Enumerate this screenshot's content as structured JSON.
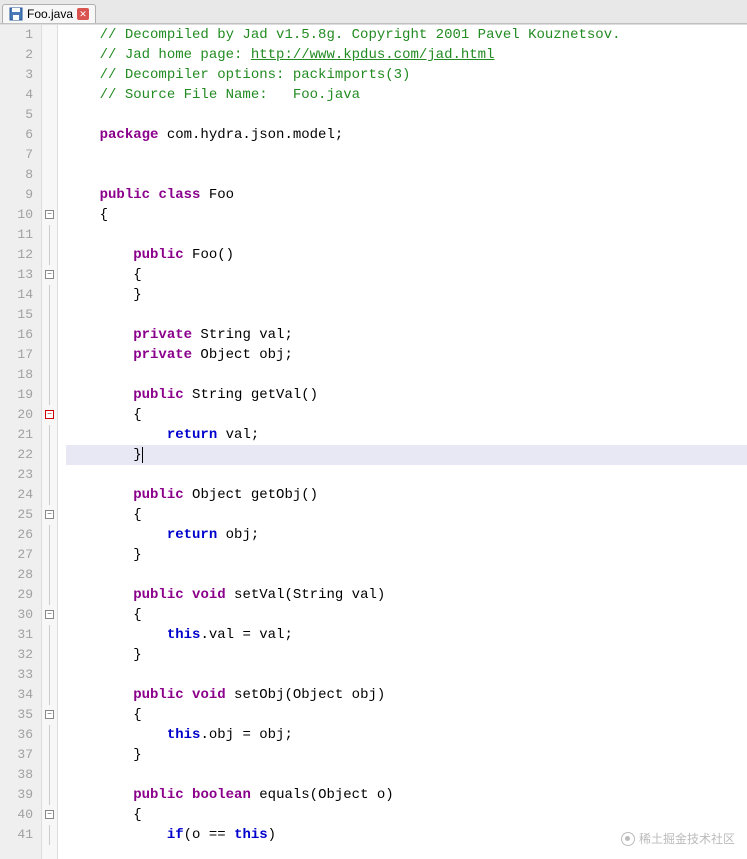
{
  "tab": {
    "filename": "Foo.java",
    "icon": "save-icon",
    "close_icon": "close-icon"
  },
  "watermark": "稀土掘金技术社区",
  "code": {
    "lines": [
      {
        "n": 1,
        "tokens": [
          {
            "t": "    ",
            "c": ""
          },
          {
            "t": "// Decompiled by Jad v1.5.8g. Copyright 2001 Pavel Kouznetsov.",
            "c": "c-comment"
          }
        ]
      },
      {
        "n": 2,
        "tokens": [
          {
            "t": "    ",
            "c": ""
          },
          {
            "t": "// Jad home page: ",
            "c": "c-comment"
          },
          {
            "t": "http://www.kpdus.com/jad.html",
            "c": "c-link"
          }
        ]
      },
      {
        "n": 3,
        "tokens": [
          {
            "t": "    ",
            "c": ""
          },
          {
            "t": "// Decompiler options: packimports(3) ",
            "c": "c-comment"
          }
        ]
      },
      {
        "n": 4,
        "tokens": [
          {
            "t": "    ",
            "c": ""
          },
          {
            "t": "// Source File Name:   Foo.java",
            "c": "c-comment"
          }
        ]
      },
      {
        "n": 5,
        "tokens": []
      },
      {
        "n": 6,
        "tokens": [
          {
            "t": "    ",
            "c": ""
          },
          {
            "t": "package",
            "c": "c-keyword"
          },
          {
            "t": " com.hydra.json.model;",
            "c": "c-default"
          }
        ]
      },
      {
        "n": 7,
        "tokens": []
      },
      {
        "n": 8,
        "tokens": []
      },
      {
        "n": 9,
        "tokens": [
          {
            "t": "    ",
            "c": ""
          },
          {
            "t": "public",
            "c": "c-keyword"
          },
          {
            "t": " ",
            "c": ""
          },
          {
            "t": "class",
            "c": "c-keyword"
          },
          {
            "t": " Foo",
            "c": "c-default"
          }
        ]
      },
      {
        "n": 10,
        "fold": "-",
        "tokens": [
          {
            "t": "    {",
            "c": "c-default"
          }
        ]
      },
      {
        "n": 11,
        "tokens": []
      },
      {
        "n": 12,
        "tokens": [
          {
            "t": "        ",
            "c": ""
          },
          {
            "t": "public",
            "c": "c-keyword"
          },
          {
            "t": " Foo()",
            "c": "c-default"
          }
        ]
      },
      {
        "n": 13,
        "fold": "-",
        "tokens": [
          {
            "t": "        {",
            "c": "c-default"
          }
        ]
      },
      {
        "n": 14,
        "tokens": [
          {
            "t": "        }",
            "c": "c-default"
          }
        ]
      },
      {
        "n": 15,
        "tokens": []
      },
      {
        "n": 16,
        "tokens": [
          {
            "t": "        ",
            "c": ""
          },
          {
            "t": "private",
            "c": "c-keyword"
          },
          {
            "t": " String val;",
            "c": "c-default"
          }
        ]
      },
      {
        "n": 17,
        "tokens": [
          {
            "t": "        ",
            "c": ""
          },
          {
            "t": "private",
            "c": "c-keyword"
          },
          {
            "t": " Object obj;",
            "c": "c-default"
          }
        ]
      },
      {
        "n": 18,
        "tokens": []
      },
      {
        "n": 19,
        "tokens": [
          {
            "t": "        ",
            "c": ""
          },
          {
            "t": "public",
            "c": "c-keyword"
          },
          {
            "t": " String getVal()",
            "c": "c-default"
          }
        ]
      },
      {
        "n": 20,
        "fold": "-red",
        "tokens": [
          {
            "t": "        {",
            "c": "c-default"
          }
        ]
      },
      {
        "n": 21,
        "tokens": [
          {
            "t": "            ",
            "c": ""
          },
          {
            "t": "return",
            "c": "c-keyword2"
          },
          {
            "t": " val;",
            "c": "c-default"
          }
        ]
      },
      {
        "n": 22,
        "hl": true,
        "caret": true,
        "tokens": [
          {
            "t": "        }",
            "c": "c-default"
          }
        ]
      },
      {
        "n": 23,
        "tokens": []
      },
      {
        "n": 24,
        "tokens": [
          {
            "t": "        ",
            "c": ""
          },
          {
            "t": "public",
            "c": "c-keyword"
          },
          {
            "t": " Object getObj()",
            "c": "c-default"
          }
        ]
      },
      {
        "n": 25,
        "fold": "-",
        "tokens": [
          {
            "t": "        {",
            "c": "c-default"
          }
        ]
      },
      {
        "n": 26,
        "tokens": [
          {
            "t": "            ",
            "c": ""
          },
          {
            "t": "return",
            "c": "c-keyword2"
          },
          {
            "t": " obj;",
            "c": "c-default"
          }
        ]
      },
      {
        "n": 27,
        "tokens": [
          {
            "t": "        }",
            "c": "c-default"
          }
        ]
      },
      {
        "n": 28,
        "tokens": []
      },
      {
        "n": 29,
        "tokens": [
          {
            "t": "        ",
            "c": ""
          },
          {
            "t": "public",
            "c": "c-keyword"
          },
          {
            "t": " ",
            "c": ""
          },
          {
            "t": "void",
            "c": "c-keyword"
          },
          {
            "t": " setVal(String val)",
            "c": "c-default"
          }
        ]
      },
      {
        "n": 30,
        "fold": "-",
        "tokens": [
          {
            "t": "        {",
            "c": "c-default"
          }
        ]
      },
      {
        "n": 31,
        "tokens": [
          {
            "t": "            ",
            "c": ""
          },
          {
            "t": "this",
            "c": "c-keyword2"
          },
          {
            "t": ".val = val;",
            "c": "c-default"
          }
        ]
      },
      {
        "n": 32,
        "tokens": [
          {
            "t": "        }",
            "c": "c-default"
          }
        ]
      },
      {
        "n": 33,
        "tokens": []
      },
      {
        "n": 34,
        "tokens": [
          {
            "t": "        ",
            "c": ""
          },
          {
            "t": "public",
            "c": "c-keyword"
          },
          {
            "t": " ",
            "c": ""
          },
          {
            "t": "void",
            "c": "c-keyword"
          },
          {
            "t": " setObj(Object obj)",
            "c": "c-default"
          }
        ]
      },
      {
        "n": 35,
        "fold": "-",
        "tokens": [
          {
            "t": "        {",
            "c": "c-default"
          }
        ]
      },
      {
        "n": 36,
        "tokens": [
          {
            "t": "            ",
            "c": ""
          },
          {
            "t": "this",
            "c": "c-keyword2"
          },
          {
            "t": ".obj = obj;",
            "c": "c-default"
          }
        ]
      },
      {
        "n": 37,
        "tokens": [
          {
            "t": "        }",
            "c": "c-default"
          }
        ]
      },
      {
        "n": 38,
        "tokens": []
      },
      {
        "n": 39,
        "tokens": [
          {
            "t": "        ",
            "c": ""
          },
          {
            "t": "public",
            "c": "c-keyword"
          },
          {
            "t": " ",
            "c": ""
          },
          {
            "t": "boolean",
            "c": "c-keyword"
          },
          {
            "t": " equals(Object o)",
            "c": "c-default"
          }
        ]
      },
      {
        "n": 40,
        "fold": "-",
        "tokens": [
          {
            "t": "        {",
            "c": "c-default"
          }
        ]
      },
      {
        "n": 41,
        "tokens": [
          {
            "t": "            ",
            "c": ""
          },
          {
            "t": "if",
            "c": "c-keyword2"
          },
          {
            "t": "(o == ",
            "c": "c-default"
          },
          {
            "t": "this",
            "c": "c-keyword2"
          },
          {
            "t": ")",
            "c": "c-default"
          }
        ]
      }
    ]
  }
}
